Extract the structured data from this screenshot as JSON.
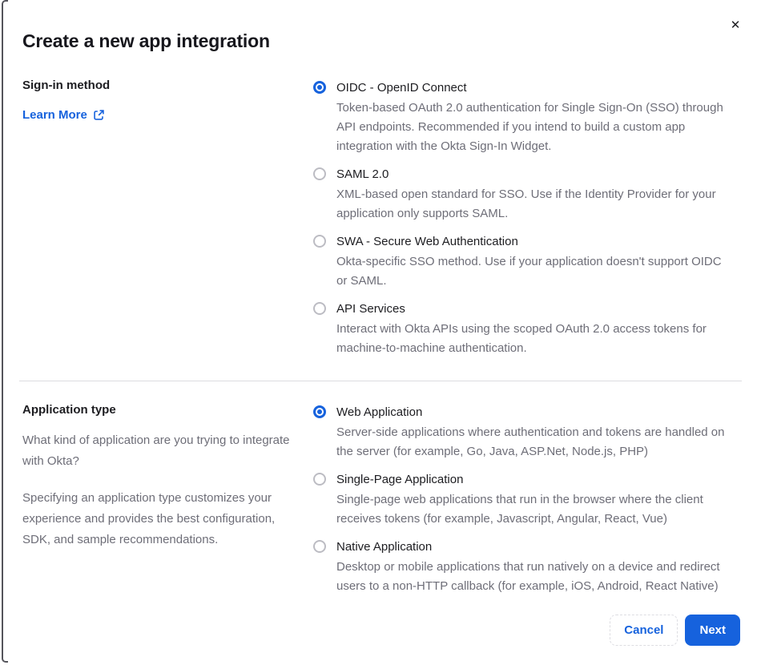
{
  "modal": {
    "title": "Create a new app integration",
    "close_icon": "✕"
  },
  "colors": {
    "accent_blue": "#1662dd",
    "text_dark": "#1d1d21",
    "text_gray": "#6e6e78",
    "divider_gray": "#dcdce1"
  },
  "signin_section": {
    "label": "Sign-in method",
    "link": {
      "label": "Learn More",
      "icon": "external-link"
    },
    "options": [
      {
        "label": "OIDC - OpenID Connect",
        "description": "Token-based OAuth 2.0 authentication for Single Sign-On (SSO) through API endpoints. Recommended if you intend to build a custom app integration with the Okta Sign-In Widget.",
        "selected": true
      },
      {
        "label": "SAML 2.0",
        "description": "XML-based open standard for SSO. Use if the Identity Provider for your application only supports SAML.",
        "selected": false
      },
      {
        "label": "SWA - Secure Web Authentication",
        "description": "Okta-specific SSO method. Use if your application doesn't support OIDC or SAML.",
        "selected": false
      },
      {
        "label": "API Services",
        "description": "Interact with Okta APIs using the scoped OAuth 2.0 access tokens for machine-to-machine authentication.",
        "selected": false
      }
    ]
  },
  "apptype_section": {
    "label": "Application type",
    "paragraphs": [
      "What kind of application are you trying to integrate with Okta?",
      "Specifying an application type customizes your experience and provides the best configuration, SDK, and sample recommendations."
    ],
    "options": [
      {
        "label": "Web Application",
        "description": "Server-side applications where authentication and tokens are handled on the server (for example, Go, Java, ASP.Net, Node.js, PHP)",
        "selected": true
      },
      {
        "label": "Single-Page Application",
        "description": "Single-page web applications that run in the browser where the client receives tokens (for example, Javascript, Angular, React, Vue)",
        "selected": false
      },
      {
        "label": "Native Application",
        "description": "Desktop or mobile applications that run natively on a device and redirect users to a non-HTTP callback (for example, iOS, Android, React Native)",
        "selected": false
      }
    ]
  },
  "footer": {
    "cancel_label": "Cancel",
    "next_label": "Next"
  }
}
